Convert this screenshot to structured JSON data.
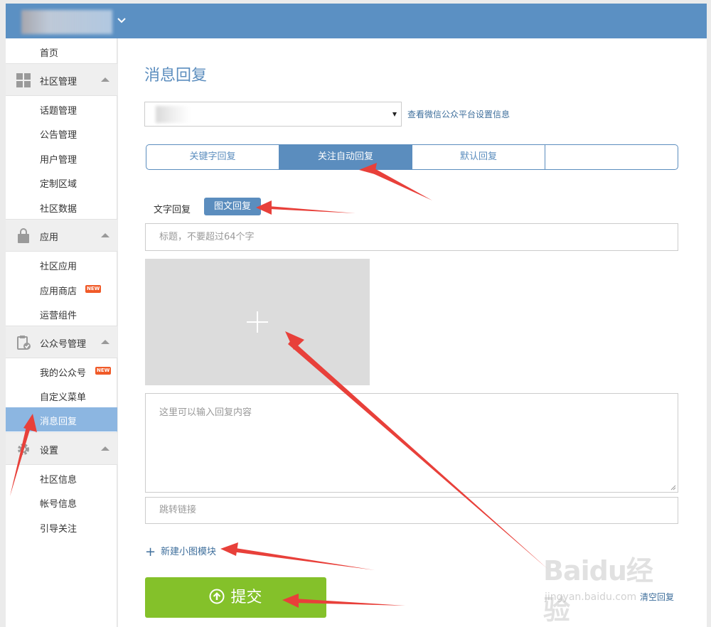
{
  "sidebar": {
    "home": "首页",
    "groups": [
      {
        "title": "社区管理",
        "icon": "grid-icon",
        "items": [
          "话题管理",
          "公告管理",
          "用户管理",
          "定制区域",
          "社区数据"
        ]
      },
      {
        "title": "应用",
        "icon": "shopping-bag-icon",
        "items": [
          "社区应用",
          "应用商店",
          "运营组件"
        ]
      },
      {
        "title": "公众号管理",
        "icon": "clipboard-check-icon",
        "items": [
          "我的公众号",
          "自定义菜单",
          "消息回复"
        ]
      },
      {
        "title": "设置",
        "icon": "gear-icon",
        "items": [
          "社区信息",
          "帐号信息",
          "引导关注"
        ]
      }
    ],
    "new_badge": "NEW",
    "active_item": "消息回复"
  },
  "main": {
    "title": "消息回复",
    "wechat_link": "查看微信公众平台设置信息",
    "tabs": [
      "关键字回复",
      "关注自动回复",
      "默认回复",
      ""
    ],
    "active_tab": "关注自动回复",
    "subtabs": [
      "文字回复",
      "图文回复"
    ],
    "active_subtab": "图文回复",
    "title_placeholder": "标题，不要超过64个字",
    "content_placeholder": "这里可以输入回复内容",
    "link_placeholder": "跳转链接",
    "add_module": "新建小图模块",
    "submit": "提交",
    "clear": "清空回复"
  },
  "watermark": {
    "logo": "Baidu经验",
    "url": "jingyan.baidu.com"
  },
  "colors": {
    "header": "#5b90c3",
    "accent": "#5b8dbe",
    "submit": "#84c12a",
    "annotation": "#e8403a",
    "sidebar_active": "#8cb6e1"
  }
}
